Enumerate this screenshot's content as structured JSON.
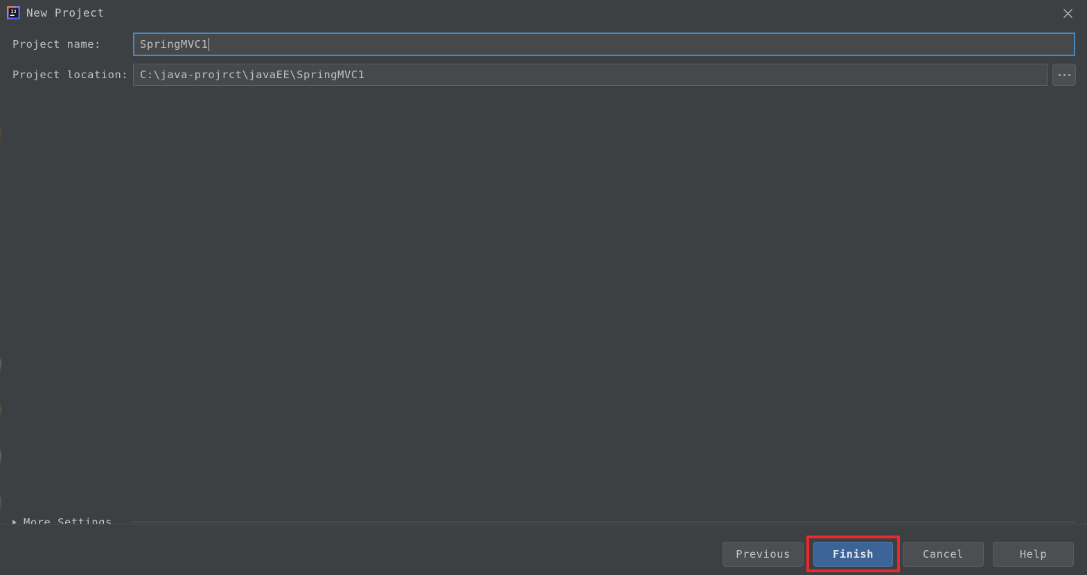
{
  "window": {
    "title": "New Project",
    "app_icon": "intellij-idea-icon",
    "close_icon": "close-icon",
    "background_color": "#3c4042"
  },
  "form": {
    "fields": [
      {
        "label": "Project name:",
        "value": "SpringMVC1",
        "focused": true,
        "focus_border_color": "#4a88c7"
      },
      {
        "label": "Project location:",
        "value": "C:\\java-projrct\\javaEE\\SpringMVC1",
        "focused": false,
        "browse_label": "...",
        "browse_icon": "ellipsis-icon"
      }
    ]
  },
  "more_settings": {
    "label": "More Settings",
    "expanded": false,
    "arrow_icon": "chevron-right-icon"
  },
  "buttons": {
    "previous": "Previous",
    "finish": "Finish",
    "cancel": "Cancel",
    "help": "Help",
    "default_button": "Finish",
    "default_button_color": "#3c6497"
  },
  "annotation": {
    "highlight_target": "Finish",
    "highlight_color": "#ef2929"
  }
}
